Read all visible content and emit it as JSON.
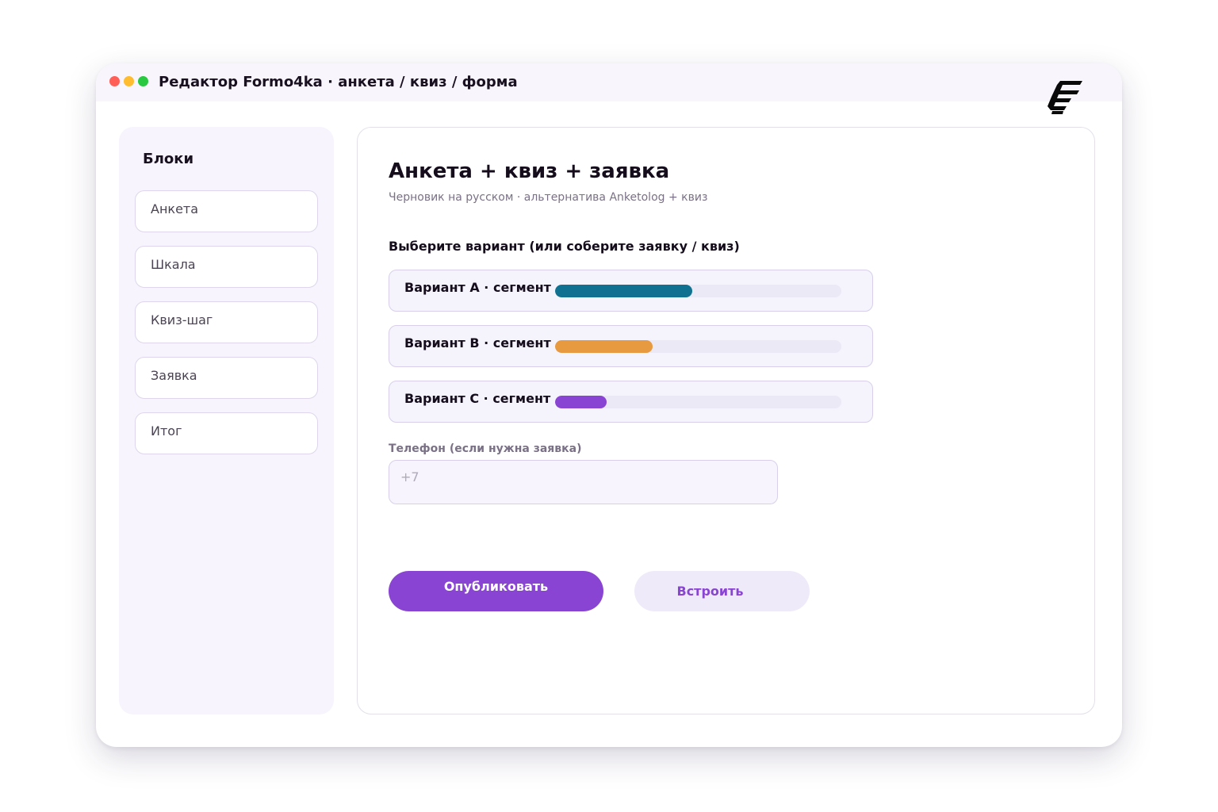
{
  "window": {
    "title": "Редактор Formo4ka · анкета / квиз / форма"
  },
  "sidebar": {
    "title": "Блоки",
    "items": [
      {
        "label": "Анкета"
      },
      {
        "label": "Шкала"
      },
      {
        "label": "Квиз-шаг"
      },
      {
        "label": "Заявка"
      },
      {
        "label": "Итог"
      }
    ]
  },
  "main": {
    "title": "Анкета + квиз + заявка",
    "subtitle": "Черновик на русском · альтернатива Anketolog + квиз",
    "question": "Выберите вариант (или соберите заявку / квиз)",
    "options": [
      {
        "label": "Вариант A · сегмент",
        "fraction": 0.48,
        "color": "#107190"
      },
      {
        "label": "Вариант B · сегмент",
        "fraction": 0.34,
        "color": "#e89a40"
      },
      {
        "label": "Вариант C · сегмент",
        "fraction": 0.18,
        "color": "#8a44d4"
      }
    ],
    "phone": {
      "label": "Телефон (если нужна заявка)",
      "placeholder": "+7",
      "value": ""
    },
    "publish_label": "Опубликовать",
    "embed_label": "Встроить"
  },
  "colors": {
    "accent": "#8a44d4",
    "sidebar_bg": "#f7f4fd",
    "option_bg": "#f5f3fc"
  },
  "icons": {
    "logo": "formo4ka-logo-icon"
  }
}
